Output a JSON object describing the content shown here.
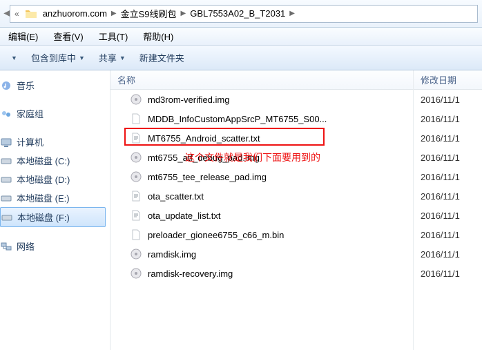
{
  "breadcrumb": {
    "segs": [
      "anzhuorom.com",
      "金立S9线刷包",
      "GBL7553A02_B_T2031"
    ]
  },
  "menubar": {
    "edit": "编辑(E)",
    "view": "查看(V)",
    "tools": "工具(T)",
    "help": "帮助(H)"
  },
  "toolbar": {
    "include": "包含到库中",
    "share": "共享",
    "newfolder": "新建文件夹"
  },
  "sidebar": {
    "music": "音乐",
    "homegroup": "家庭组",
    "computer": "计算机",
    "disks": [
      "本地磁盘 (C:)",
      "本地磁盘 (D:)",
      "本地磁盘 (E:)",
      "本地磁盘 (F:)"
    ],
    "network": "网络"
  },
  "columns": {
    "name": "名称",
    "date": "修改日期"
  },
  "files": [
    {
      "name": "md3rom-verified.img",
      "date": "2016/11/1",
      "type": "img"
    },
    {
      "name": "MDDB_InfoCustomAppSrcP_MT6755_S00...",
      "date": "2016/11/1",
      "type": "blank"
    },
    {
      "name": "MT6755_Android_scatter.txt",
      "date": "2016/11/1",
      "type": "txt"
    },
    {
      "name": "mt6755_atf_debug_pad.img",
      "date": "2016/11/1",
      "type": "img"
    },
    {
      "name": "mt6755_tee_release_pad.img",
      "date": "2016/11/1",
      "type": "img"
    },
    {
      "name": "ota_scatter.txt",
      "date": "2016/11/1",
      "type": "txt"
    },
    {
      "name": "ota_update_list.txt",
      "date": "2016/11/1",
      "type": "txt"
    },
    {
      "name": "preloader_gionee6755_c66_m.bin",
      "date": "2016/11/1",
      "type": "blank"
    },
    {
      "name": "ramdisk.img",
      "date": "2016/11/1",
      "type": "img"
    },
    {
      "name": "ramdisk-recovery.img",
      "date": "2016/11/1",
      "type": "img"
    }
  ],
  "annotation": "这个文件就是我们下面要用到的"
}
